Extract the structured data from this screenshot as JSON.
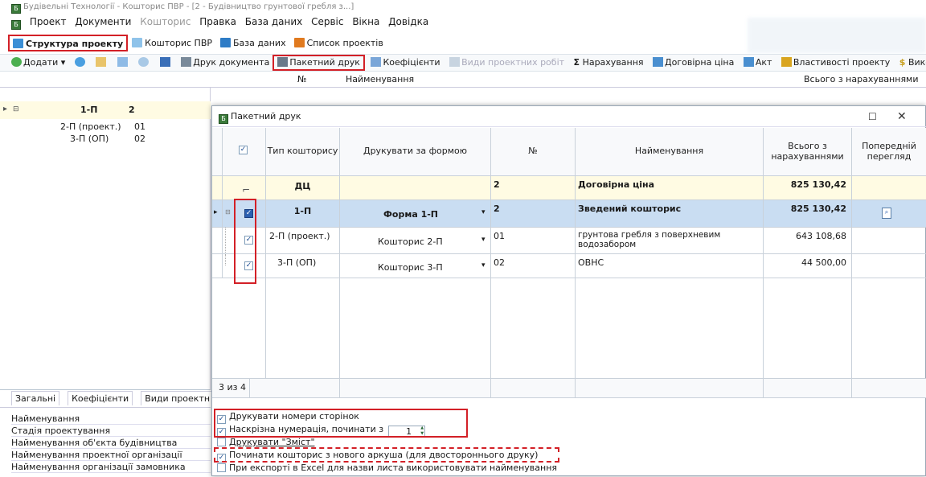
{
  "window": {
    "title": "Будівельні Технології - Кошторис ПВР - [2 - Будівництво грунтової гребля з...]"
  },
  "menu": {
    "items": [
      "Проект",
      "Документи",
      "Кошторис",
      "Правка",
      "База даних",
      "Сервіс",
      "Вікна",
      "Довідка"
    ]
  },
  "tabs": {
    "items": [
      {
        "label": "Структура проекту",
        "active": true
      },
      {
        "label": "Кошторис ПВР",
        "active": false
      },
      {
        "label": "База даних",
        "active": false
      },
      {
        "label": "Список проектів",
        "active": false
      }
    ]
  },
  "toolbar": {
    "add": "Додати",
    "print_doc": "Друк документа",
    "batch_print": "Пакетний друк",
    "coefficients": "Коефіцієнти",
    "work_types": "Види проектних робіт",
    "charges": "Нарахування",
    "contract_price": "Договірна ціна",
    "act": "Акт",
    "project_props": "Властивості проекту",
    "more": "Вико"
  },
  "bg_table": {
    "col_no": "№",
    "col_name": "Найменування",
    "col_total": "Всього з нарахуваннями"
  },
  "tree": {
    "root_code": "1-П",
    "root_no": "2",
    "children": [
      {
        "code": "2-П (проект.)",
        "no": "01"
      },
      {
        "code": "3-П (ОП)",
        "no": "02"
      }
    ]
  },
  "bottom_left": {
    "tabs": [
      "Загальні",
      "Коефіцієнти",
      "Види проектн"
    ],
    "props": [
      "Найменування",
      "Стадія проектування",
      "Найменування об'єкта будівництва",
      "Найменування проектної організації",
      "Найменування організації замовника"
    ]
  },
  "dialog": {
    "title": "Пакетний друк",
    "columns": {
      "type": "Тип кошторису",
      "form": "Друкувати за формою",
      "no": "№",
      "name": "Найменування",
      "total": "Всього з нарахуваннями",
      "preview": "Попередній перегляд"
    },
    "rows": [
      {
        "checked": false,
        "type": "ДЦ",
        "form": "",
        "no": "2",
        "name": "Договірна ціна",
        "total": "825 130,42"
      },
      {
        "checked": true,
        "type": "1-П",
        "form": "Форма 1-П",
        "no": "2",
        "name": "Зведений кошторис",
        "total": "825 130,42"
      },
      {
        "checked": true,
        "type": "2-П (проект.)",
        "form": "Кошторис 2-П",
        "no": "01",
        "name": "грунтова гребля з поверхневим водозабором",
        "total": "643 108,68"
      },
      {
        "checked": true,
        "type": "3-П (ОП)",
        "form": "Кошторис 3-П",
        "no": "02",
        "name": "ОВНС",
        "total": "44 500,00"
      }
    ],
    "count_label": "3 из 4",
    "options": {
      "page_numbers": "Друкувати номери сторінок",
      "through_numbering": "Наскрізна нумерація, починати з",
      "start_value": "1",
      "print_contents": "Друкувати \"Зміст\"",
      "new_sheet": "Починати кошторис з нового аркуша (для двостороннього друку)",
      "excel_sheet": "При експорті в Excel для назви листа використовувати найменування"
    }
  },
  "colors": {
    "highlight_red": "#d32027",
    "selected_row": "#c9ddf2",
    "first_row": "#fffbe3"
  }
}
